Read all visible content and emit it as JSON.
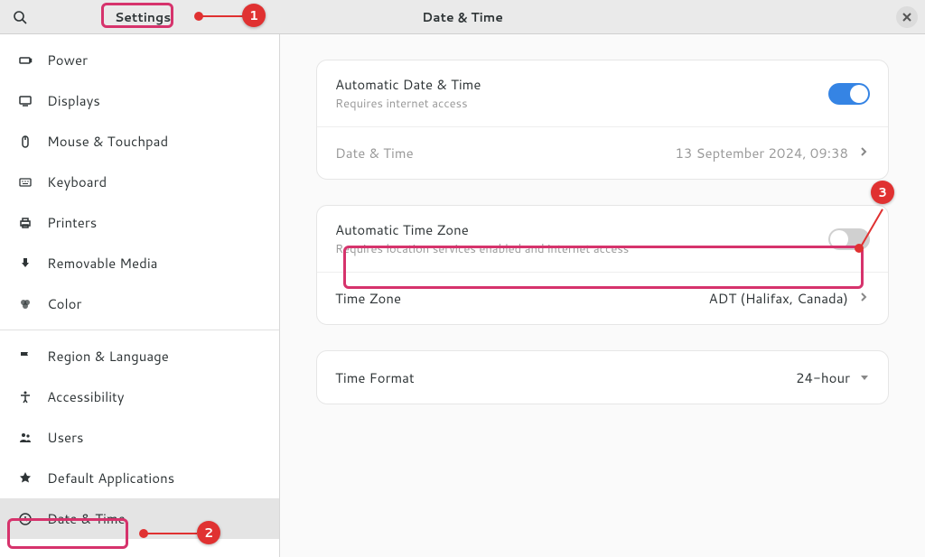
{
  "header": {
    "settings_title": "Settings",
    "main_title": "Date & Time"
  },
  "sidebar": {
    "items": [
      {
        "label": "Power",
        "icon": "power-icon"
      },
      {
        "label": "Displays",
        "icon": "displays-icon"
      },
      {
        "label": "Mouse & Touchpad",
        "icon": "mouse-icon"
      },
      {
        "label": "Keyboard",
        "icon": "keyboard-icon"
      },
      {
        "label": "Printers",
        "icon": "printer-icon"
      },
      {
        "label": "Removable Media",
        "icon": "removable-icon"
      },
      {
        "label": "Color",
        "icon": "color-icon"
      },
      {
        "label": "Region & Language",
        "icon": "region-icon"
      },
      {
        "label": "Accessibility",
        "icon": "accessibility-icon"
      },
      {
        "label": "Users",
        "icon": "users-icon"
      },
      {
        "label": "Default Applications",
        "icon": "default-apps-icon"
      },
      {
        "label": "Date & Time",
        "icon": "datetime-icon"
      }
    ]
  },
  "panel": {
    "auto_datetime": {
      "title": "Automatic Date & Time",
      "subtitle": "Requires internet access",
      "enabled": true
    },
    "datetime": {
      "title": "Date & Time",
      "value": "13 September 2024, 09:38"
    },
    "auto_tz": {
      "title": "Automatic Time Zone",
      "subtitle": "Requires location services enabled and internet access",
      "enabled": false
    },
    "timezone": {
      "title": "Time Zone",
      "value": "ADT (Halifax, Canada)"
    },
    "timeformat": {
      "title": "Time Format",
      "value": "24-hour"
    }
  },
  "annotations": {
    "one": "1",
    "two": "2",
    "three": "3"
  }
}
